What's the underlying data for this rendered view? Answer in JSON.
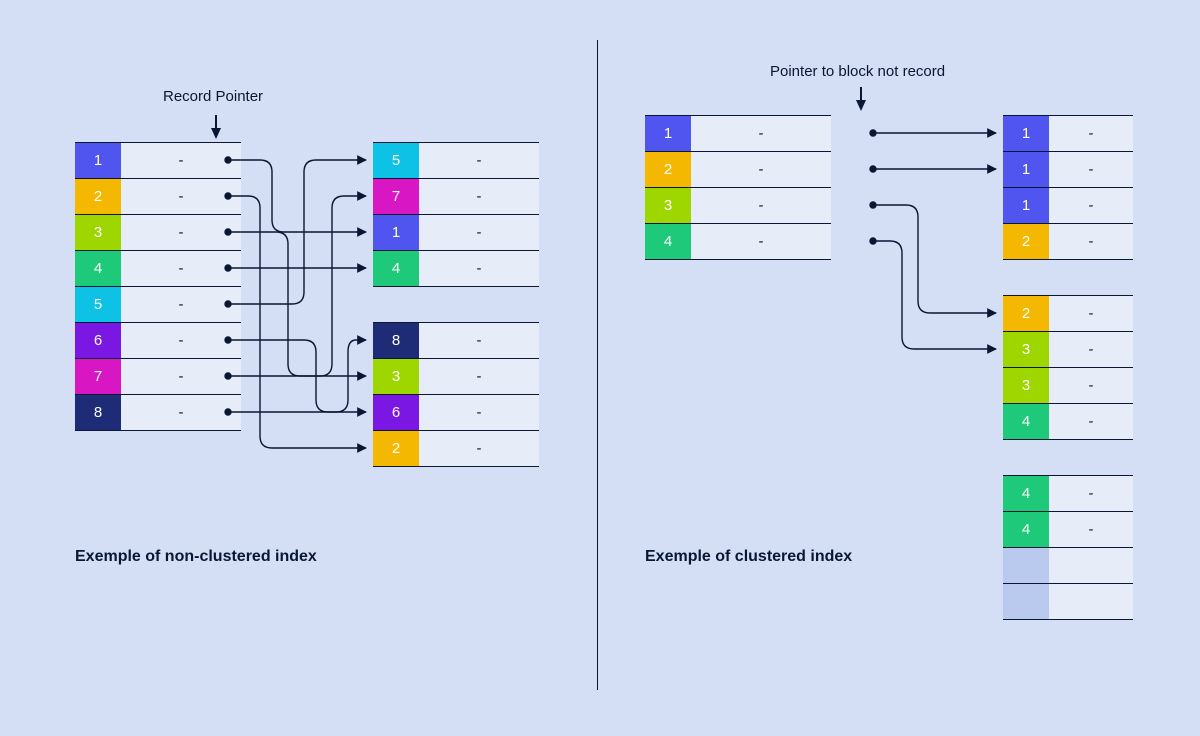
{
  "nonclustered": {
    "title_label": "Record Pointer",
    "caption": "Exemple of non-clustered index",
    "index_rows": [
      {
        "key": "1",
        "color": "#4f55ee",
        "ptr": "-"
      },
      {
        "key": "2",
        "color": "#f5b800",
        "ptr": "-"
      },
      {
        "key": "3",
        "color": "#9ed600",
        "ptr": "-"
      },
      {
        "key": "4",
        "color": "#1fc97a",
        "ptr": "-"
      },
      {
        "key": "5",
        "color": "#0ec2e5",
        "ptr": "-"
      },
      {
        "key": "6",
        "color": "#7a17e2",
        "ptr": "-"
      },
      {
        "key": "7",
        "color": "#d816c4",
        "ptr": "-"
      },
      {
        "key": "8",
        "color": "#1e2b77",
        "ptr": "-"
      }
    ],
    "block_a": [
      {
        "key": "5",
        "color": "#0ec2e5",
        "ptr": "-"
      },
      {
        "key": "7",
        "color": "#d816c4",
        "ptr": "-"
      },
      {
        "key": "1",
        "color": "#4f55ee",
        "ptr": "-"
      },
      {
        "key": "4",
        "color": "#1fc97a",
        "ptr": "-"
      }
    ],
    "block_b": [
      {
        "key": "8",
        "color": "#1e2b77",
        "ptr": "-"
      },
      {
        "key": "3",
        "color": "#9ed600",
        "ptr": "-"
      },
      {
        "key": "6",
        "color": "#7a17e2",
        "ptr": "-"
      },
      {
        "key": "2",
        "color": "#f5b800",
        "ptr": "-"
      }
    ]
  },
  "clustered": {
    "title_label": "Pointer to block not record",
    "caption": "Exemple of clustered index",
    "index_rows": [
      {
        "key": "1",
        "color": "#4f55ee",
        "ptr": "-"
      },
      {
        "key": "2",
        "color": "#f5b800",
        "ptr": "-"
      },
      {
        "key": "3",
        "color": "#9ed600",
        "ptr": "-"
      },
      {
        "key": "4",
        "color": "#1fc97a",
        "ptr": "-"
      }
    ],
    "block_a": [
      {
        "key": "1",
        "color": "#4f55ee",
        "ptr": "-"
      },
      {
        "key": "1",
        "color": "#4f55ee",
        "ptr": "-"
      },
      {
        "key": "1",
        "color": "#4f55ee",
        "ptr": "-"
      },
      {
        "key": "2",
        "color": "#f5b800",
        "ptr": "-"
      }
    ],
    "block_b": [
      {
        "key": "2",
        "color": "#f5b800",
        "ptr": "-"
      },
      {
        "key": "3",
        "color": "#9ed600",
        "ptr": "-"
      },
      {
        "key": "3",
        "color": "#9ed600",
        "ptr": "-"
      },
      {
        "key": "4",
        "color": "#1fc97a",
        "ptr": "-"
      }
    ],
    "block_c": [
      {
        "key": "4",
        "color": "#1fc97a",
        "ptr": "-"
      },
      {
        "key": "4",
        "color": "#1fc97a",
        "ptr": "-"
      },
      {
        "key": "",
        "color": "",
        "ptr": ""
      },
      {
        "key": "",
        "color": "",
        "ptr": ""
      }
    ]
  }
}
